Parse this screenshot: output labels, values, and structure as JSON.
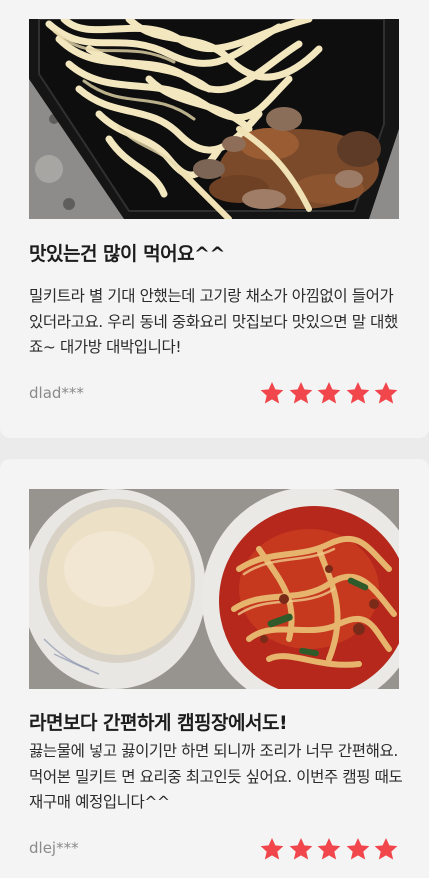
{
  "reviews": [
    {
      "title": "맛있는건 많이 먹어요^^",
      "body": "밀키트라 별 기대 안했는데 고기랑 채소가 아낌없이 들어가 있더라고요. 우리 동네 중화요리 맛집보다 맛있으면 말 대했죠~ 대가방 대박입니다!",
      "author": "dlad***",
      "rating": 5,
      "photo_subject": "udon noodles with pork and mushrooms in black container"
    },
    {
      "title": "라면보다 간편하게 캠핑장에서도!",
      "body": "끓는물에 넣고 끓이기만 하면 되니까 조리가 너무 간편해요. 먹어본 밀키트 면 요리중 최고인듯 싶어요. 이번주 캠핑 때도 재구매 예정입니다^^",
      "author": "dlej***",
      "rating": 5,
      "photo_subject": "bowl of broth and bowl of spicy red noodle soup"
    }
  ],
  "colors": {
    "star": "#f0464c",
    "card_bg": "#f4f4f4",
    "page_bg": "#ebebeb",
    "author": "#8a8a8a"
  },
  "icons": {
    "rating": "star-icon"
  }
}
